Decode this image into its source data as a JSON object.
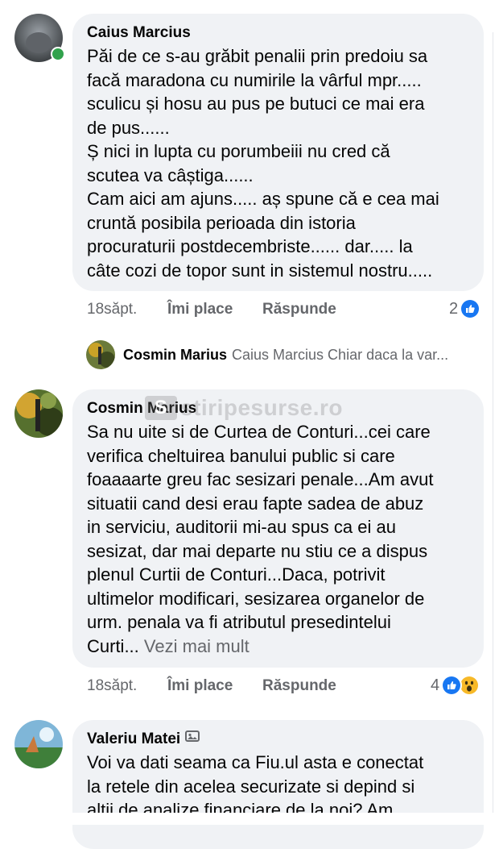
{
  "colors": {
    "bubble": "#f0f2f5",
    "meta": "#65676b",
    "like_blue": "#1877f2",
    "online_green": "#31a24c"
  },
  "comments": [
    {
      "author": "Caius Marcius",
      "online": true,
      "text": "Păi de ce s-au grăbit penalii prin predoiu sa\nfacă maradona cu numirile la vârful mpr.....\nsculicu și hosu au pus pe butuci ce mai era\nde pus......\nȘ nici in lupta cu porumbeiii nu cred că\nscutea va câștiga......\nCam aici am ajuns..... aș spune că e cea mai\ncruntă posibila perioada din istoria\nprocuraturii postdecembriste...... dar..... la\ncâte cozi de topor sunt in sistemul nostru.....",
      "time": "18săpt.",
      "like_label": "Îmi place",
      "reply_label": "Răspunde",
      "reaction_count": "2",
      "reactions": [
        "like-icon"
      ]
    },
    {
      "author": "Cosmin Marius",
      "online": false,
      "text": "Sa nu uite si de Curtea de Conturi...cei care\nverifica cheltuirea banului public si care\nfoaaaarte greu fac sesizari penale...Am avut\nsituatii cand desi erau fapte sadea de abuz\nin serviciu, auditorii mi-au spus ca ei au\nsesizat, dar mai departe nu stiu ce a dispus\nplenul Curtii de Conturi...Daca, potrivit\nultimelor modificari, sesizarea organelor de\nurm. penala va fi atributul presedintelui\nCurti...",
      "see_more": "Vezi mai mult",
      "time": "18săpt.",
      "like_label": "Îmi place",
      "reply_label": "Răspunde",
      "reaction_count": "4",
      "reactions": [
        "like-icon",
        "wow-icon"
      ]
    },
    {
      "author": "Valeriu Matei",
      "badge_icon": "image-comment-icon",
      "text": "Voi va dati seama ca Fiu.ul asta e conectat\nla retele din acelea securizate si depind si\naltii de analize financiare de la noi? Am"
    }
  ],
  "reply_preview": {
    "author": "Cosmin Marius",
    "text": "Caius Marcius Chiar daca la var..."
  },
  "watermark": {
    "logo": "S",
    "text": "stiripesurse.ro"
  }
}
